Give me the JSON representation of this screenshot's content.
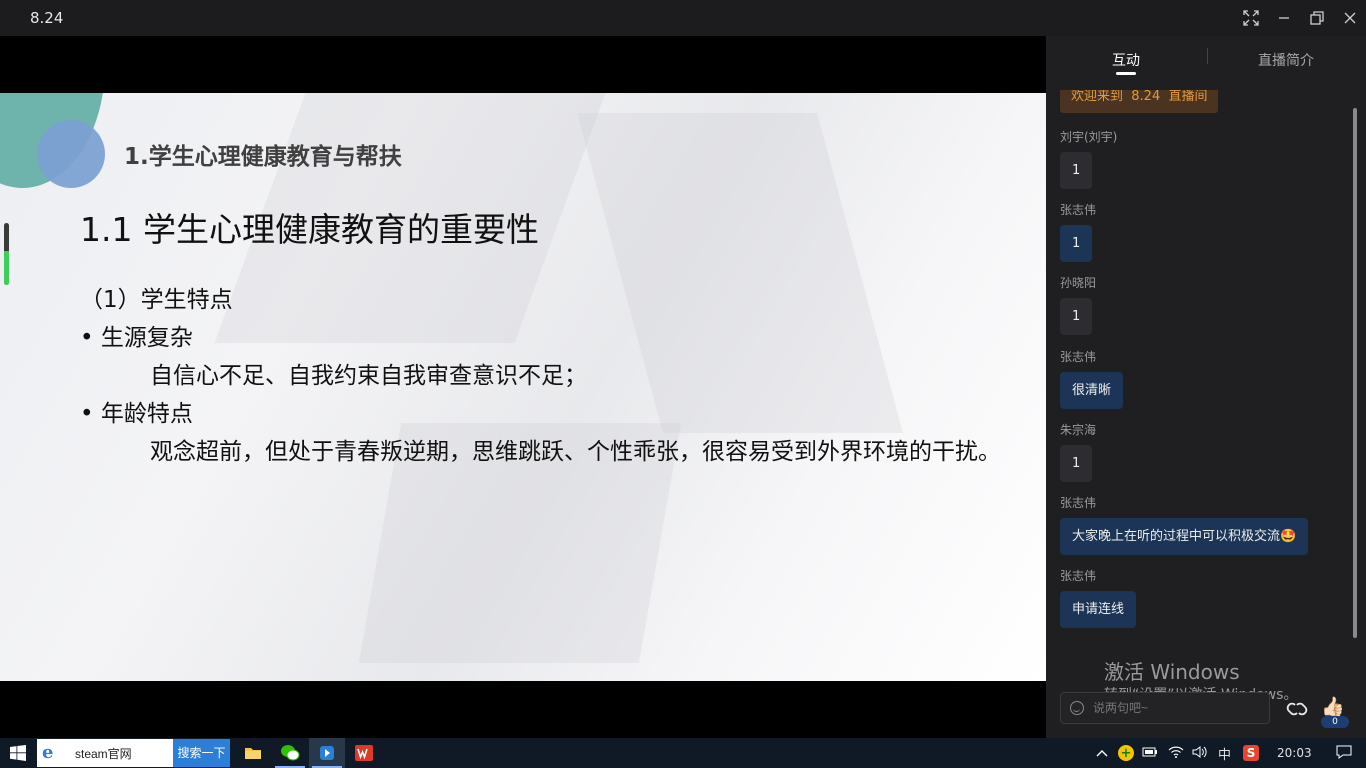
{
  "window": {
    "title": "8.24"
  },
  "slide": {
    "header": "1.学生心理健康教育与帮扶",
    "subtitle": "1.1 学生心理健康教育的重要性",
    "section": "（1）学生特点",
    "bullet1": "生源复杂",
    "bullet1_detail": "自信心不足、自我约束自我审查意识不足；",
    "bullet2": "年龄特点",
    "bullet2_detail": "观念超前，但处于青春叛逆期，思维跳跃、个性乖张，很容易受到外界环境的干扰。"
  },
  "volume_level": 0.55,
  "panel": {
    "tabs": [
      {
        "label": "互动",
        "active": true
      },
      {
        "label": "直播简介",
        "active": false
      }
    ],
    "welcome": "欢迎来到  8.24  直播间",
    "messages": [
      {
        "name": "刘宇(刘宇)",
        "text": "1",
        "style": "dark"
      },
      {
        "name": "张志伟",
        "text": "1",
        "style": "blue"
      },
      {
        "name": "孙晓阳",
        "text": "1",
        "style": "dark"
      },
      {
        "name": "张志伟",
        "text": "很清晰",
        "style": "blue"
      },
      {
        "name": "朱宗海",
        "text": "1",
        "style": "dark"
      },
      {
        "name": "张志伟",
        "text": "大家晚上在听的过程中可以积极交流🤩",
        "style": "blue"
      },
      {
        "name": "张志伟",
        "text": "申请连线",
        "style": "blue"
      }
    ],
    "input_placeholder": "说两句吧~",
    "like_count": "0",
    "watermark_title": "激活 Windows",
    "watermark_sub": "转到“设置”以激活 Windows。"
  },
  "taskbar": {
    "search_value": "steam官网",
    "search_button": "搜索一下",
    "ime": "中",
    "time": "20:03"
  },
  "colors": {
    "panel_bg": "#1f1f22",
    "bubble_blue": "#1c3556",
    "welcome_text": "#e39a3d",
    "taskbar_bg": "#0f1a26"
  }
}
